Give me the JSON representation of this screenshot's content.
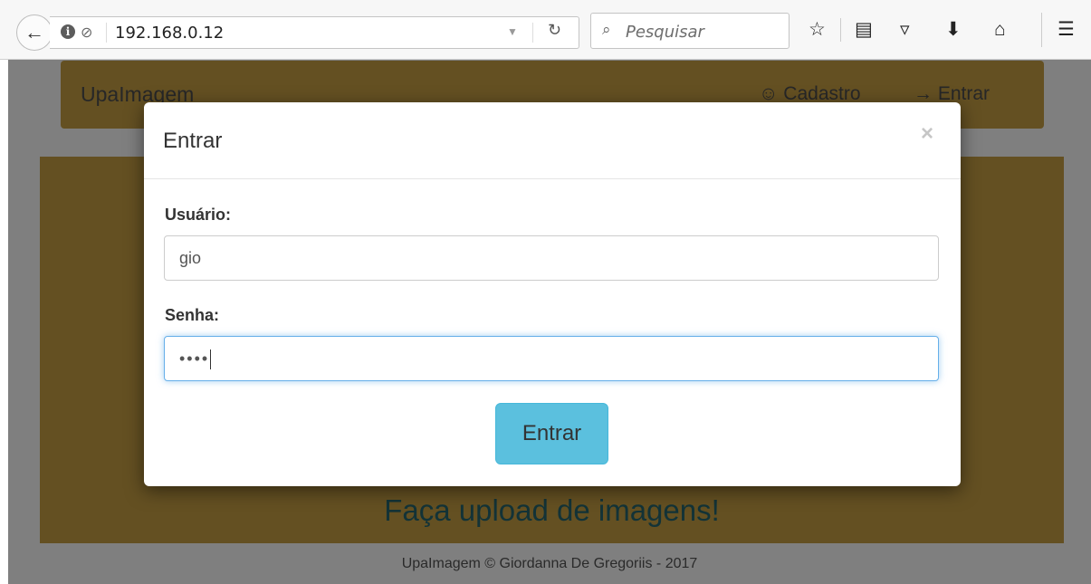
{
  "browser": {
    "url": "192.168.0.12",
    "search_placeholder": "Pesquisar"
  },
  "page": {
    "brand": "UpaImagem",
    "nav": {
      "cadastro": "Cadastro",
      "entrar": "Entrar"
    },
    "hero_text": "Faça upload de imagens!",
    "footer": "UpaImagem © Giordanna De Gregoriis - 2017",
    "colors": {
      "navbar": "#c8a045",
      "hero_text": "#26666f",
      "button": "#5bc0de"
    }
  },
  "modal": {
    "title": "Entrar",
    "close": "×",
    "username_label": "Usuário:",
    "username_value": "gio",
    "password_label": "Senha:",
    "password_value": "••••",
    "submit_label": "Entrar"
  }
}
